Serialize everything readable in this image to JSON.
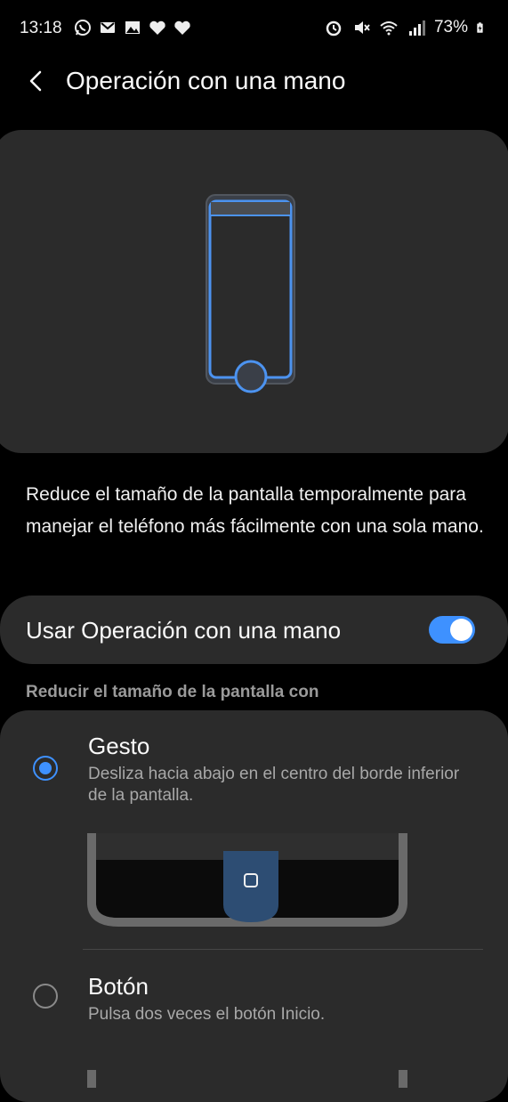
{
  "status_bar": {
    "time": "13:18",
    "left_icons": [
      "whatsapp-icon",
      "gmail-icon",
      "gallery-icon",
      "heart-icon",
      "heart-icon"
    ],
    "right_icons": [
      "alarm-icon",
      "mute-icon",
      "wifi-icon",
      "signal-icon",
      "battery-charging-icon"
    ],
    "battery": "73%"
  },
  "app_bar": {
    "title": "Operación con una mano"
  },
  "description": "Reduce el tamaño de la pantalla temporalmente para manejar el teléfono más fácilmente con una sola mano.",
  "main_toggle": {
    "label": "Usar Operación con una mano",
    "enabled": true
  },
  "section_header": "Reducir el tamaño de la pantalla con",
  "options": [
    {
      "title": "Gesto",
      "subtitle": "Desliza hacia abajo en el centro del borde inferior de la pantalla.",
      "selected": true
    },
    {
      "title": "Botón",
      "subtitle": "Pulsa dos veces el botón Inicio.",
      "selected": false
    }
  ],
  "colors": {
    "accent": "#3e91ff",
    "card": "#2b2b2b",
    "background": "#000000"
  }
}
